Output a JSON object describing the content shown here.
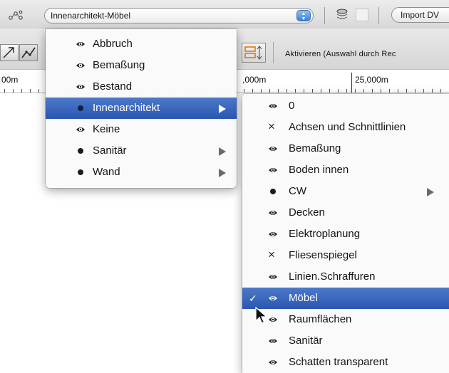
{
  "toolbar": {
    "layer_select_value": "Innenarchitekt-Möbel",
    "import_button_label": "Import DV",
    "activate_label": "Aktivieren (Auswahl durch Rec"
  },
  "ruler": {
    "labels": [
      "00m",
      ",000m",
      "25,000m"
    ]
  },
  "main_menu": {
    "items": [
      {
        "label": "Abbruch",
        "icon": "eye-icon"
      },
      {
        "label": "Bemaßung",
        "icon": "eye-icon"
      },
      {
        "label": "Bestand",
        "icon": "eye-icon"
      },
      {
        "label": "Innenarchitekt",
        "icon": "dot-icon",
        "has_submenu": true,
        "highlighted": true
      },
      {
        "label": "Keine",
        "icon": "eye-icon"
      },
      {
        "label": "Sanitär",
        "icon": "dot-icon",
        "has_submenu": true
      },
      {
        "label": "Wand",
        "icon": "dot-icon",
        "has_submenu": true
      }
    ]
  },
  "sub_menu": {
    "items": [
      {
        "label": "0",
        "icon": "eye-icon"
      },
      {
        "label": "Achsen und Schnittlinien",
        "icon": "x-icon"
      },
      {
        "label": "Bemaßung",
        "icon": "eye-icon"
      },
      {
        "label": "Boden innen",
        "icon": "eye-icon"
      },
      {
        "label": "CW",
        "icon": "dot-icon",
        "has_submenu": true
      },
      {
        "label": "Decken",
        "icon": "eye-icon"
      },
      {
        "label": "Elektroplanung",
        "icon": "eye-icon"
      },
      {
        "label": "Fliesenspiegel",
        "icon": "x-icon"
      },
      {
        "label": "Linien.Schraffuren",
        "icon": "eye-icon"
      },
      {
        "label": "Möbel",
        "icon": "eye-icon",
        "checked": true,
        "highlighted": true
      },
      {
        "label": "Raumflächen",
        "icon": "eye-icon"
      },
      {
        "label": "Sanitär",
        "icon": "eye-icon"
      },
      {
        "label": "Schatten transparent",
        "icon": "eye-icon"
      }
    ]
  },
  "colors": {
    "highlight": "#2f5bb7",
    "toolbar": "#dedede"
  }
}
